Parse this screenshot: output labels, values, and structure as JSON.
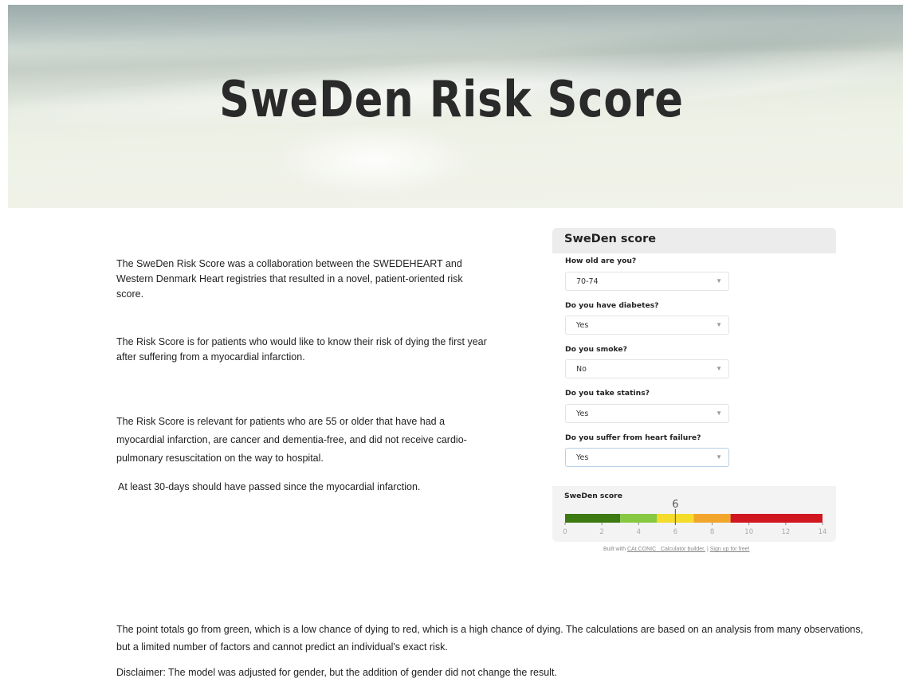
{
  "hero": {
    "title": "SweDen Risk Score"
  },
  "intro": {
    "p1": "The SweDen Risk Score was a collaboration between the SWEDEHEART and Western Denmark Heart registries that resulted in a novel, patient-oriented risk score.",
    "p2": "The Risk Score is for patients who would like to know their risk of dying the first year after suffering from a myocardial infarction.",
    "p3": "The Risk Score is relevant for patients who are 55 or older that have had a myocardial infarction, are cancer and dementia-free, and did not receive cardio-pulmonary resuscitation on the way to hospital.",
    "p4": "At least 30-days should have passed since the myocardial infarction."
  },
  "calculator": {
    "title": "SweDen score",
    "questions": [
      {
        "label": "How old are you?",
        "value": "70-74"
      },
      {
        "label": "Do you have diabetes?",
        "value": "Yes"
      },
      {
        "label": "Do you smoke?",
        "value": "No"
      },
      {
        "label": "Do you take statins?",
        "value": "Yes"
      },
      {
        "label": "Do you suffer from heart failure?",
        "value": "Yes"
      }
    ],
    "score": {
      "label": "SweDen score",
      "value": 6,
      "value_text": "6",
      "min": 0,
      "max": 14,
      "ticks": [
        "0",
        "2",
        "4",
        "6",
        "8",
        "10",
        "12",
        "14"
      ],
      "segments": [
        {
          "from": 0,
          "to": 3,
          "color": "#3d7a12"
        },
        {
          "from": 3,
          "to": 5,
          "color": "#86c940"
        },
        {
          "from": 5,
          "to": 7,
          "color": "#f5dc2a"
        },
        {
          "from": 7,
          "to": 9,
          "color": "#f2a52b"
        },
        {
          "from": 9,
          "to": 14,
          "color": "#d0161e"
        }
      ]
    },
    "footer": {
      "prefix": "Built with",
      "link1": "CALCONIC_ Calculator builder.",
      "separator": "|",
      "link2": "Sign up for free!"
    }
  },
  "bottom": {
    "p1": "The point totals go from green, which is a low chance of dying to red, which is a high chance of dying. The calculations are based on an analysis from many observations, but a limited number of factors and cannot predict an individual's exact risk.",
    "p2": "Disclaimer: The model was adjusted for gender, but the addition of gender did not change the result."
  }
}
